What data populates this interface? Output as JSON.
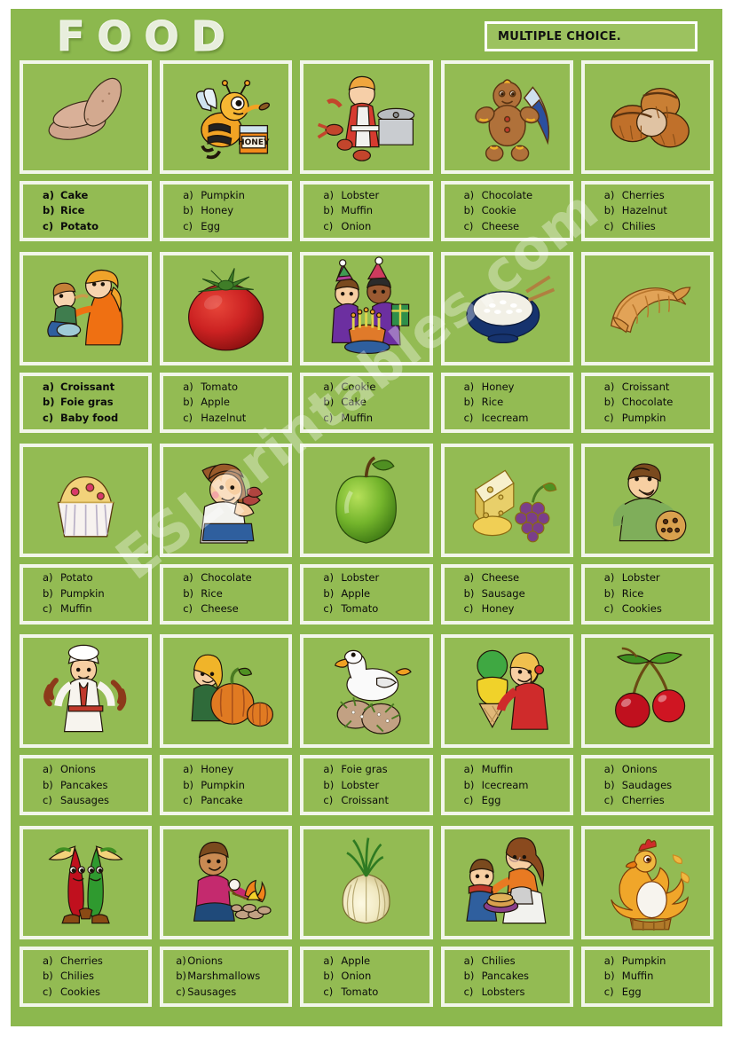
{
  "header": {
    "title_letters": [
      "F",
      "O",
      "O",
      "D"
    ],
    "instruction": "MULTIPLE CHOICE."
  },
  "watermark": "ESLprintables.com",
  "colors": {
    "panel_green": "#8cb84e",
    "cell_green": "#93bb53",
    "border_white": "#f2f6ea",
    "text_black": "#0b0b0b",
    "title_cream": "#e8eedd"
  },
  "cells": [
    {
      "id": 1,
      "picture": "potatoes",
      "bold": false,
      "tight": false,
      "options": [
        {
          "key": "a)",
          "label": "Cake"
        },
        {
          "key": "b)",
          "label": "Rice"
        },
        {
          "key": "c)",
          "label": "Potato"
        }
      ],
      "style": "bold"
    },
    {
      "id": 2,
      "picture": "bee-with-honey-jar",
      "bold": false,
      "tight": false,
      "options": [
        {
          "key": "a)",
          "label": "Pumpkin"
        },
        {
          "key": "b)",
          "label": "Honey"
        },
        {
          "key": "c)",
          "label": "Egg"
        }
      ]
    },
    {
      "id": 3,
      "picture": "chef-with-lobster",
      "options": [
        {
          "key": "a)",
          "label": "Lobster"
        },
        {
          "key": "b)",
          "label": "Muffin"
        },
        {
          "key": "c)",
          "label": "Onion"
        }
      ]
    },
    {
      "id": 4,
      "picture": "gingerbread-man",
      "options": [
        {
          "key": "a)",
          "label": "Chocolate"
        },
        {
          "key": "b)",
          "label": "Cookie"
        },
        {
          "key": "c)",
          "label": "Cheese"
        }
      ]
    },
    {
      "id": 5,
      "picture": "hazelnuts",
      "options": [
        {
          "key": "a)",
          "label": "Cherries"
        },
        {
          "key": "b)",
          "label": "Hazelnut"
        },
        {
          "key": "c)",
          "label": "Chilies"
        }
      ]
    },
    {
      "id": 6,
      "picture": "mother-feeding-baby",
      "style": "bold",
      "options": [
        {
          "key": "a)",
          "label": "Croissant"
        },
        {
          "key": "b)",
          "label": "Foie gras"
        },
        {
          "key": "c)",
          "label": "Baby food"
        }
      ]
    },
    {
      "id": 7,
      "picture": "tomato",
      "options": [
        {
          "key": "a)",
          "label": "Tomato"
        },
        {
          "key": "b)",
          "label": "Apple"
        },
        {
          "key": "c)",
          "label": "Hazelnut"
        }
      ]
    },
    {
      "id": 8,
      "picture": "birthday-cake-kids",
      "options": [
        {
          "key": "a)",
          "label": "Cookie"
        },
        {
          "key": "b)",
          "label": "Cake"
        },
        {
          "key": "c)",
          "label": "Muffin"
        }
      ]
    },
    {
      "id": 9,
      "picture": "rice-bowl-chopsticks",
      "options": [
        {
          "key": "a)",
          "label": "Honey"
        },
        {
          "key": "b)",
          "label": "Rice"
        },
        {
          "key": "c)",
          "label": "Icecream"
        }
      ]
    },
    {
      "id": 10,
      "picture": "croissant",
      "options": [
        {
          "key": "a)",
          "label": "Croissant"
        },
        {
          "key": "b)",
          "label": "Chocolate"
        },
        {
          "key": "c)",
          "label": "Pumpkin"
        }
      ]
    },
    {
      "id": 11,
      "picture": "cupcake",
      "options": [
        {
          "key": "a)",
          "label": "Potato"
        },
        {
          "key": "b)",
          "label": "Pumpkin"
        },
        {
          "key": "c)",
          "label": "Muffin"
        }
      ]
    },
    {
      "id": 12,
      "picture": "girl-eating-chocolate",
      "options": [
        {
          "key": "a)",
          "label": "Chocolate"
        },
        {
          "key": "b)",
          "label": "Rice"
        },
        {
          "key": "c)",
          "label": "Cheese"
        }
      ]
    },
    {
      "id": 13,
      "picture": "green-apple",
      "options": [
        {
          "key": "a)",
          "label": "Lobster"
        },
        {
          "key": "b)",
          "label": "Apple"
        },
        {
          "key": "c)",
          "label": "Tomato"
        }
      ]
    },
    {
      "id": 14,
      "picture": "cheese-and-grapes",
      "options": [
        {
          "key": "a)",
          "label": "Cheese"
        },
        {
          "key": "b)",
          "label": "Sausage"
        },
        {
          "key": "c)",
          "label": "Honey"
        }
      ]
    },
    {
      "id": 15,
      "picture": "man-eating-cookie",
      "options": [
        {
          "key": "a)",
          "label": "Lobster"
        },
        {
          "key": "b)",
          "label": "Rice"
        },
        {
          "key": "c)",
          "label": "Cookies"
        }
      ]
    },
    {
      "id": 16,
      "picture": "butcher-with-sausages",
      "options": [
        {
          "key": "a)",
          "label": "Onions"
        },
        {
          "key": "b)",
          "label": "Pancakes"
        },
        {
          "key": "c)",
          "label": "Sausages"
        }
      ]
    },
    {
      "id": 17,
      "picture": "boy-with-pumpkins",
      "options": [
        {
          "key": "a)",
          "label": "Honey"
        },
        {
          "key": "b)",
          "label": "Pumpkin"
        },
        {
          "key": "c)",
          "label": "Pancake"
        }
      ]
    },
    {
      "id": 18,
      "picture": "goose-with-pate",
      "options": [
        {
          "key": "a)",
          "label": "Foie gras"
        },
        {
          "key": "b)",
          "label": "Lobster"
        },
        {
          "key": "c)",
          "label": "Croissant"
        }
      ]
    },
    {
      "id": 19,
      "picture": "girl-with-icecream",
      "options": [
        {
          "key": "a)",
          "label": "Muffin"
        },
        {
          "key": "b)",
          "label": "Icecream"
        },
        {
          "key": "c)",
          "label": "Egg"
        }
      ]
    },
    {
      "id": 20,
      "picture": "cherries",
      "options": [
        {
          "key": "a)",
          "label": "Onions"
        },
        {
          "key": "b)",
          "label": "Saudages"
        },
        {
          "key": "c)",
          "label": "Cherries"
        }
      ]
    },
    {
      "id": 21,
      "picture": "chili-peppers-characters",
      "options": [
        {
          "key": "a)",
          "label": "Cherries"
        },
        {
          "key": "b)",
          "label": "Chilies"
        },
        {
          "key": "c)",
          "label": "Cookies"
        }
      ]
    },
    {
      "id": 22,
      "picture": "boy-roasting-marshmallow",
      "style": "tight",
      "options": [
        {
          "key": "a)",
          "label": "Onions"
        },
        {
          "key": "b)",
          "label": "Marshmallows"
        },
        {
          "key": "c)",
          "label": "Sausages"
        }
      ]
    },
    {
      "id": 23,
      "picture": "onion",
      "options": [
        {
          "key": "a)",
          "label": "Apple"
        },
        {
          "key": "b)",
          "label": "Onion"
        },
        {
          "key": "c)",
          "label": "Tomato"
        }
      ]
    },
    {
      "id": 24,
      "picture": "mother-serving-pancakes",
      "options": [
        {
          "key": "a)",
          "label": "Chilies"
        },
        {
          "key": "b)",
          "label": "Pancakes"
        },
        {
          "key": "c)",
          "label": "Lobsters"
        }
      ]
    },
    {
      "id": 25,
      "picture": "hen-with-egg",
      "options": [
        {
          "key": "a)",
          "label": "Pumpkin"
        },
        {
          "key": "b)",
          "label": "Muffin"
        },
        {
          "key": "c)",
          "label": "Egg"
        }
      ]
    }
  ]
}
